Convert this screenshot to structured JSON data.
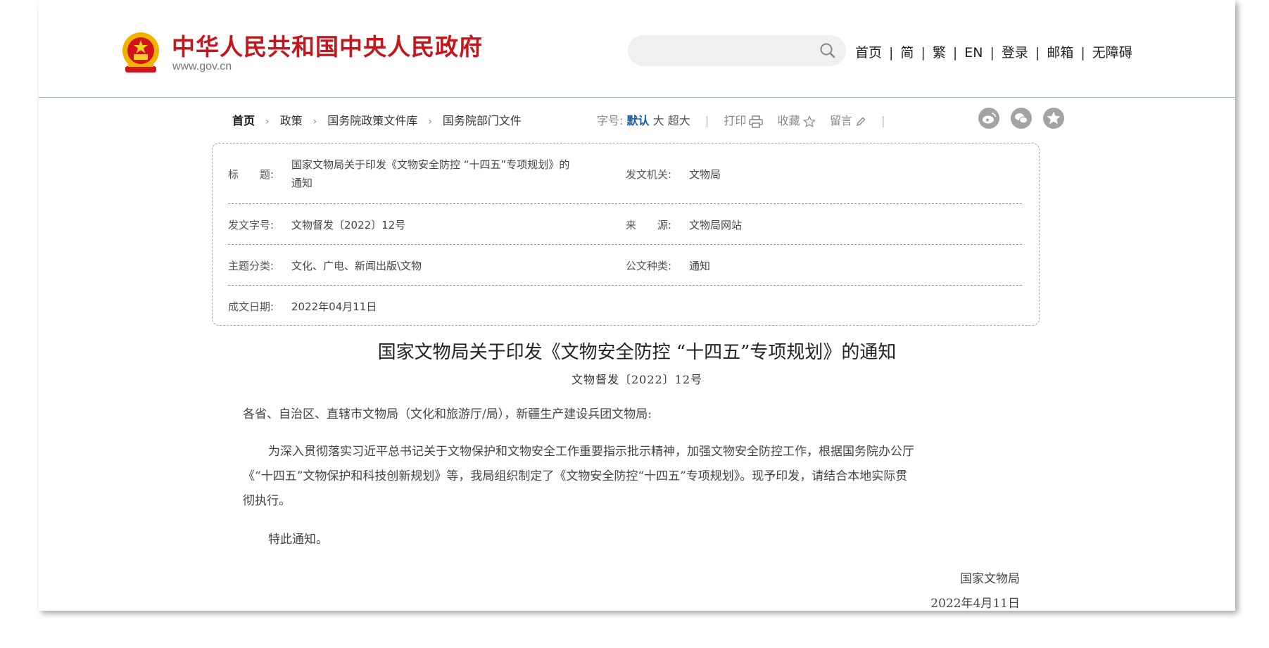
{
  "header": {
    "site_title": "中华人民共和国中央人民政府",
    "site_url": "www.gov.cn",
    "search": {
      "placeholder": ""
    },
    "nav": [
      "首页",
      "简",
      "繁",
      "EN",
      "登录",
      "邮箱",
      "无障碍"
    ],
    "nav_separator": "|"
  },
  "breadcrumb": [
    "首页",
    "政策",
    "国务院政策文件库",
    "国务院部门文件"
  ],
  "breadcrumb_arrow": "›",
  "toolbar": {
    "font_label": "字号:",
    "font_default": "默认",
    "font_large": "大",
    "font_xlarge": "超大",
    "print": "打印",
    "favorite": "收藏",
    "comment": "留言",
    "separator": "|"
  },
  "share_icons": [
    "weibo-icon",
    "wechat-icon",
    "star-share-icon"
  ],
  "info": {
    "title_label": "标　　题:",
    "title_line1": "国家文物局关于印发《文物安全防控 “十四五”专项规划》的",
    "title_line2": "通知",
    "issuer_label": "发文机关:",
    "issuer": "文物局",
    "docno_label": "发文字号:",
    "docno": "文物督发〔2022〕12号",
    "source_label": "来　　源:",
    "source": "文物局网站",
    "topic_label": "主题分类:",
    "topic": "文化、广电、新闻出版\\文物",
    "type_label": "公文种类:",
    "type": "通知",
    "date_label": "成文日期:",
    "date": "2022年04月11日"
  },
  "article": {
    "title": "国家文物局关于印发《文物安全防控 “十四五”专项规划》的通知",
    "doc_number": "文物督发〔2022〕12号",
    "salutation": "各省、自治区、直辖市文物局（文化和旅游厅/局），新疆生产建设兵团文物局:",
    "body_line1": "为深入贯彻落实习近平总书记关于文物保护和文物安全工作重要指示批示精神，加强文物安全防控工作，根据国务院办公厅",
    "body_line2": "《“十四五”文物保护和科技创新规划》等，我局组织制定了《文物安全防控“十四五”专项规划》。现予印发，请结合本地实际贯",
    "body_line3": "彻执行。",
    "closing": "特此通知。",
    "signature": "国家文物局",
    "sign_date": "2022年4月11日"
  },
  "colors": {
    "brand_red": "#c4161c",
    "link_blue": "#1a5ea8",
    "emblem_gold": "#f2b200"
  }
}
